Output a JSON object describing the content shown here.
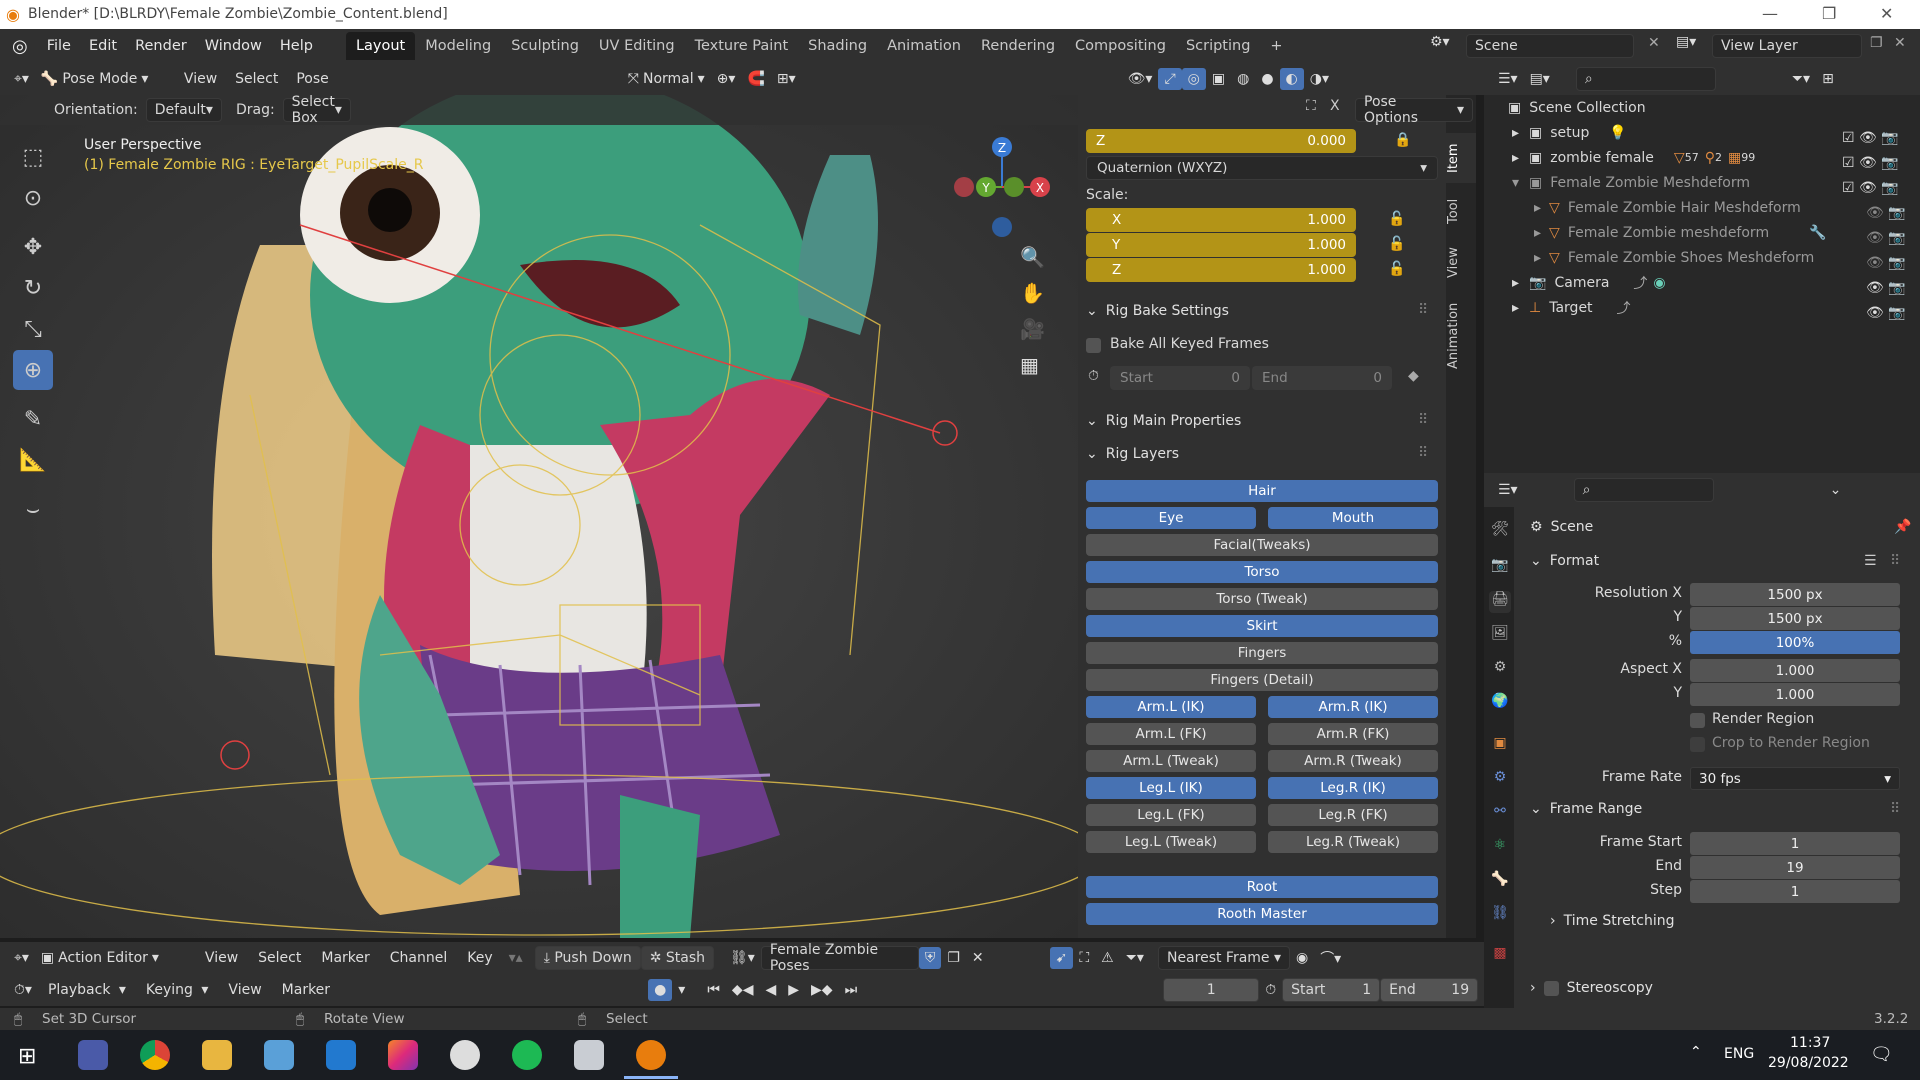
{
  "window": {
    "title": "Blender* [D:\\BLRDY\\Female Zombie\\Zombie_Content.blend]"
  },
  "menu": [
    "File",
    "Edit",
    "Render",
    "Window",
    "Help"
  ],
  "workspaces": [
    "Layout",
    "Modeling",
    "Sculpting",
    "UV Editing",
    "Texture Paint",
    "Shading",
    "Animation",
    "Rendering",
    "Compositing",
    "Scripting"
  ],
  "scene": {
    "name": "Scene",
    "view_layer": "View Layer"
  },
  "viewport_header": {
    "mode": "Pose Mode",
    "menus": [
      "View",
      "Select",
      "Pose"
    ],
    "orientation_main": "Normal"
  },
  "tool_header": {
    "orientation_label": "Orientation:",
    "orientation": "Default",
    "drag_label": "Drag:",
    "drag": "Select Box",
    "pose_options": "Pose Options"
  },
  "viewport": {
    "perspective": "User Perspective",
    "active_object": "(1) Female Zombie RIG : EyeTarget_PupilScale_R"
  },
  "gizmo": {
    "x": "X",
    "y": "Y",
    "z": "Z"
  },
  "npanel": {
    "tabs": [
      "Item",
      "Tool",
      "View",
      "Animation"
    ],
    "rot_z": {
      "label": "Z",
      "value": "0.000"
    },
    "rotation_mode": "Quaternion (WXYZ)",
    "scale_label": "Scale:",
    "scale": [
      {
        "label": "X",
        "value": "1.000"
      },
      {
        "label": "Y",
        "value": "1.000"
      },
      {
        "label": "Z",
        "value": "1.000"
      }
    ],
    "bake_title": "Rig Bake Settings",
    "bake_all": "Bake All Keyed Frames",
    "bake_start_label": "Start",
    "bake_start": "0",
    "bake_end_label": "End",
    "bake_end": "0",
    "main_props": "Rig Main Properties",
    "layers_title": "Rig Layers",
    "layers": {
      "hair": "Hair",
      "eye": "Eye",
      "mouth": "Mouth",
      "facial": "Facial(Tweaks)",
      "torso": "Torso",
      "torso_tweak": "Torso (Tweak)",
      "skirt": "Skirt",
      "fingers": "Fingers",
      "fingers_detail": "Fingers (Detail)",
      "arm_l_ik": "Arm.L (IK)",
      "arm_r_ik": "Arm.R (IK)",
      "arm_l_fk": "Arm.L (FK)",
      "arm_r_fk": "Arm.R (FK)",
      "arm_l_tw": "Arm.L (Tweak)",
      "arm_r_tw": "Arm.R (Tweak)",
      "leg_l_ik": "Leg.L (IK)",
      "leg_r_ik": "Leg.R (IK)",
      "leg_l_fk": "Leg.L (FK)",
      "leg_r_fk": "Leg.R (FK)",
      "leg_l_tw": "Leg.L (Tweak)",
      "leg_r_tw": "Leg.R (Tweak)",
      "root": "Root",
      "rooth_master": "Rooth Master"
    }
  },
  "outliner": {
    "root": "Scene Collection",
    "items": [
      {
        "name": "setup"
      },
      {
        "name": "zombie female",
        "badge1": "57",
        "badge2": "2",
        "badge3": "99"
      },
      {
        "name": "Female Zombie Meshdeform"
      },
      {
        "name": "Female Zombie Hair Meshdeform"
      },
      {
        "name": "Female Zombie meshdeform"
      },
      {
        "name": "Female Zombie Shoes Meshdeform"
      },
      {
        "name": "Camera"
      },
      {
        "name": "Target"
      }
    ]
  },
  "properties": {
    "context": "Scene",
    "format_title": "Format",
    "resolution_x_label": "Resolution X",
    "resolution_x": "1500 px",
    "resolution_y_label": "Y",
    "resolution_y": "1500 px",
    "percent_label": "%",
    "percent": "100%",
    "aspect_x_label": "Aspect X",
    "aspect_x": "1.000",
    "aspect_y_label": "Y",
    "aspect_y": "1.000",
    "render_region": "Render Region",
    "crop_region": "Crop to Render Region",
    "frame_rate_label": "Frame Rate",
    "frame_rate": "30 fps",
    "frame_range_title": "Frame Range",
    "frame_start_label": "Frame Start",
    "frame_start": "1",
    "end_label": "End",
    "end": "19",
    "step_label": "Step",
    "step": "1",
    "time_stretching": "Time Stretching",
    "stereoscopy": "Stereoscopy"
  },
  "action_editor": {
    "mode": "Action Editor",
    "menus": [
      "View",
      "Select",
      "Marker",
      "Channel",
      "Key"
    ],
    "push_down": "Push Down",
    "stash": "Stash",
    "action": "Female Zombie Poses",
    "snap": "Nearest Frame"
  },
  "timeline": {
    "menus": [
      "Playback",
      "Keying",
      "View",
      "Marker"
    ],
    "current": "1",
    "start_label": "Start",
    "start": "1",
    "end_label": "End",
    "end": "19"
  },
  "status": {
    "left": "Set 3D Cursor",
    "mid": "Rotate View",
    "right": "Select",
    "version": "3.2.2"
  },
  "taskbar": {
    "lang": "ENG",
    "time": "11:37",
    "date": "29/08/2022"
  }
}
